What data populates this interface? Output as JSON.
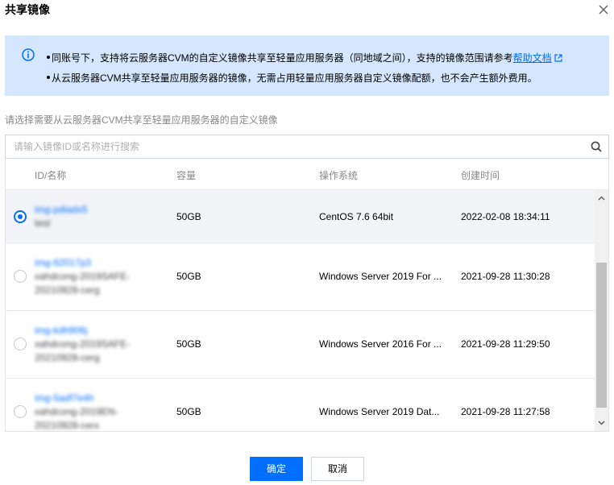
{
  "dialog": {
    "title": "共享镜像"
  },
  "notice": {
    "line1_text": "同账号下，支持将云服务器CVM的自定义镜像共享至轻量应用服务器（同地域之间），支持的镜像范围请参考",
    "line1_link": "帮助文档",
    "line2_text": "从云服务器CVM共享至轻量应用服务器的镜像，无需占用轻量应用服务器自定义镜像配额，也不会产生额外费用。"
  },
  "hint": "请选择需要从云服务器CVM共享至轻量应用服务器的自定义镜像",
  "search": {
    "placeholder": "请输入镜像ID或名称进行搜索"
  },
  "table": {
    "columns": [
      "ID/名称",
      "容量",
      "操作系统",
      "创建时间"
    ],
    "rows": [
      {
        "id": "img-pdiadx5",
        "name": "test",
        "name2": "",
        "capacity": "50GB",
        "os": "CentOS 7.6 64bit",
        "created": "2022-02-08 18:34:11",
        "selected": true
      },
      {
        "id": "img-62017p3",
        "name": "xahdcong-2019SAFE-",
        "name2": "20210928-cerg",
        "capacity": "50GB",
        "os": "Windows Server 2019 For ...",
        "created": "2021-09-28 11:30:28",
        "selected": false
      },
      {
        "id": "img-kdh906j",
        "name": "xahdcong-2019SAFE-",
        "name2": "20210928-cerg",
        "capacity": "50GB",
        "os": "Windows Server 2016 For ...",
        "created": "2021-09-28 11:29:50",
        "selected": false
      },
      {
        "id": "img-5adf7e4h",
        "name": "xahdcong-2019EN-",
        "name2": "20210928-cerx",
        "capacity": "50GB",
        "os": "Windows Server 2019 Dat...",
        "created": "2021-09-28 11:27:58",
        "selected": false
      }
    ]
  },
  "buttons": {
    "ok": "确定",
    "cancel": "取消"
  },
  "colors": {
    "accent": "#006eff",
    "notice_bg": "#d5e7ff",
    "selected_row_bg": "#f2f4f8"
  }
}
